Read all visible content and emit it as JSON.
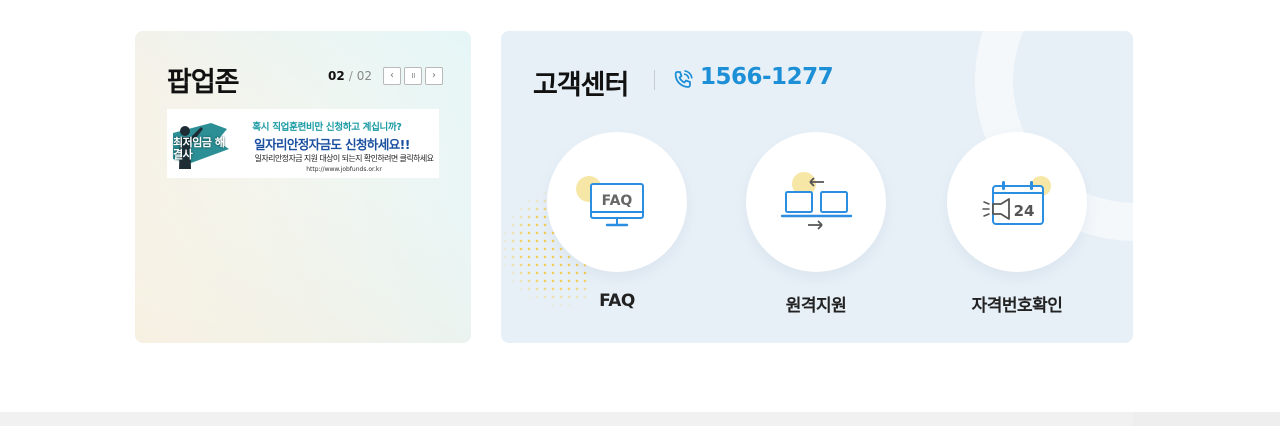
{
  "popup_zone": {
    "title": "팝업존",
    "pager": {
      "current": "02",
      "separator": "/",
      "total": "02"
    },
    "controls": [
      {
        "name": "prev",
        "icon": "chevron-left-icon",
        "glyph": "‹"
      },
      {
        "name": "pause",
        "icon": "pause-icon",
        "glyph": "॥"
      },
      {
        "name": "next",
        "icon": "chevron-right-icon",
        "glyph": "›"
      }
    ],
    "banner": {
      "badge": "최저임금 해결사",
      "line1": "혹시 직업훈련비만 신청하고 계십니까?",
      "line2": "일자리안정자금도 신청하세요!!",
      "line3": "일자리안정자금 지원 대상이 되는지 확인하려면 클릭하세요",
      "line4": "http://www.jobfunds.or.kr"
    }
  },
  "customer_center": {
    "title": "고객센터",
    "phone": "1566-1277",
    "services": [
      {
        "label": "FAQ",
        "icon": "faq-monitor-icon",
        "icon_text": "FAQ"
      },
      {
        "label": "원격지원",
        "icon": "remote-support-icon"
      },
      {
        "label": "자격번호확인",
        "icon": "calendar-24-icon",
        "icon_text": "24"
      }
    ]
  },
  "colors": {
    "accent_blue": "#1c8fd6",
    "icon_blue": "#2b8ee0",
    "icon_yellow": "#f7e7a6",
    "cs_background": "#e8f0f7"
  }
}
